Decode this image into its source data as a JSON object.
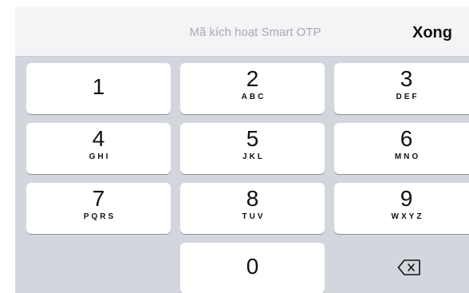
{
  "toolbar": {
    "title": "Mã kích hoạt Smart OTP",
    "done_label": "Xong"
  },
  "keypad": {
    "keys": [
      {
        "digit": "1",
        "letters": ""
      },
      {
        "digit": "2",
        "letters": "ABC"
      },
      {
        "digit": "3",
        "letters": "DEF"
      },
      {
        "digit": "4",
        "letters": "GHI"
      },
      {
        "digit": "5",
        "letters": "JKL"
      },
      {
        "digit": "6",
        "letters": "MNO"
      },
      {
        "digit": "7",
        "letters": "PQRS"
      },
      {
        "digit": "8",
        "letters": "TUV"
      },
      {
        "digit": "9",
        "letters": "WXYZ"
      },
      {
        "digit": "0",
        "letters": ""
      }
    ],
    "delete_icon": "backspace-icon"
  },
  "colors": {
    "keyboard_background": "#d3d6dc",
    "key_background": "#ffffff",
    "toolbar_background": "#f3f4f6",
    "title_text": "#a8aaae",
    "key_text": "#111111"
  }
}
